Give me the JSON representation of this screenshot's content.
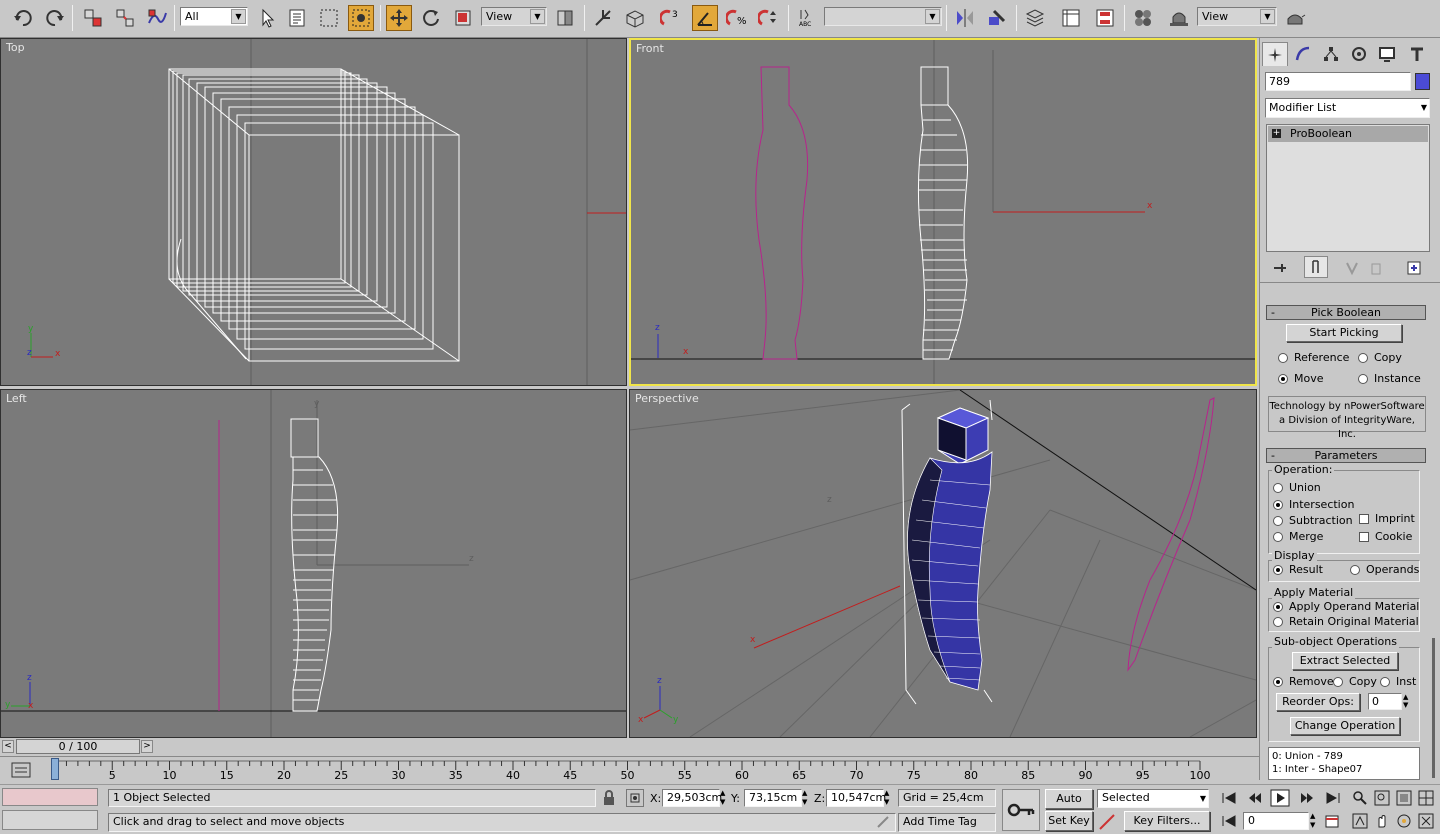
{
  "toolbar": {
    "selection_filter": "All",
    "ref_coord": "View",
    "named_selection": "",
    "render_view": "View"
  },
  "viewports": {
    "top": "Top",
    "front": "Front",
    "left": "Left",
    "perspective": "Perspective"
  },
  "command_panel": {
    "object_name": "789",
    "object_color": "#4b4bd6",
    "modifier_list": "Modifier List",
    "stack_item": "ProBoolean",
    "pick_boolean": {
      "title": "Pick Boolean",
      "start_picking": "Start Picking",
      "reference": "Reference",
      "copy": "Copy",
      "move": "Move",
      "instance": "Instance",
      "tech_line1": "Technology by nPowerSoftware",
      "tech_line2": "a Division of IntegrityWare, Inc."
    },
    "parameters": {
      "title": "Parameters",
      "operation_label": "Operation:",
      "union": "Union",
      "intersection": "Intersection",
      "subtraction": "Subtraction",
      "merge": "Merge",
      "imprint": "Imprint",
      "cookie": "Cookie",
      "display_label": "Display",
      "result": "Result",
      "operands": "Operands",
      "apply_material_label": "Apply Material",
      "apply_operand": "Apply Operand Material",
      "retain_original": "Retain Original Material",
      "subobj_label": "Sub-object Operations",
      "extract_selected": "Extract Selected",
      "remove": "Remove",
      "copy": "Copy",
      "inst": "Inst",
      "reorder_ops": "Reorder Ops:",
      "reorder_value": "0",
      "change_operation": "Change Operation",
      "op_list": [
        "0: Union - 789",
        "1: Inter - Shape07"
      ]
    }
  },
  "timeline": {
    "frame_display": "0 / 100",
    "ticks": [
      "5",
      "10",
      "15",
      "20",
      "25",
      "30",
      "35",
      "40",
      "45",
      "50",
      "55",
      "60",
      "65",
      "70",
      "75",
      "80",
      "85",
      "90",
      "95",
      "100"
    ]
  },
  "status": {
    "selection_info": "1 Object Selected",
    "prompt": "Click and drag to select and move objects",
    "x_label": "X:",
    "x_value": "29,503cm",
    "y_label": "Y:",
    "y_value": "73,15cm",
    "z_label": "Z:",
    "z_value": "10,547cm",
    "grid": "Grid = 25,4cm",
    "add_time_tag": "Add Time Tag",
    "auto_key": "Auto Key",
    "set_key": "Set Key",
    "key_mode": "Selected",
    "key_filters": "Key Filters...",
    "current_frame": "0"
  }
}
